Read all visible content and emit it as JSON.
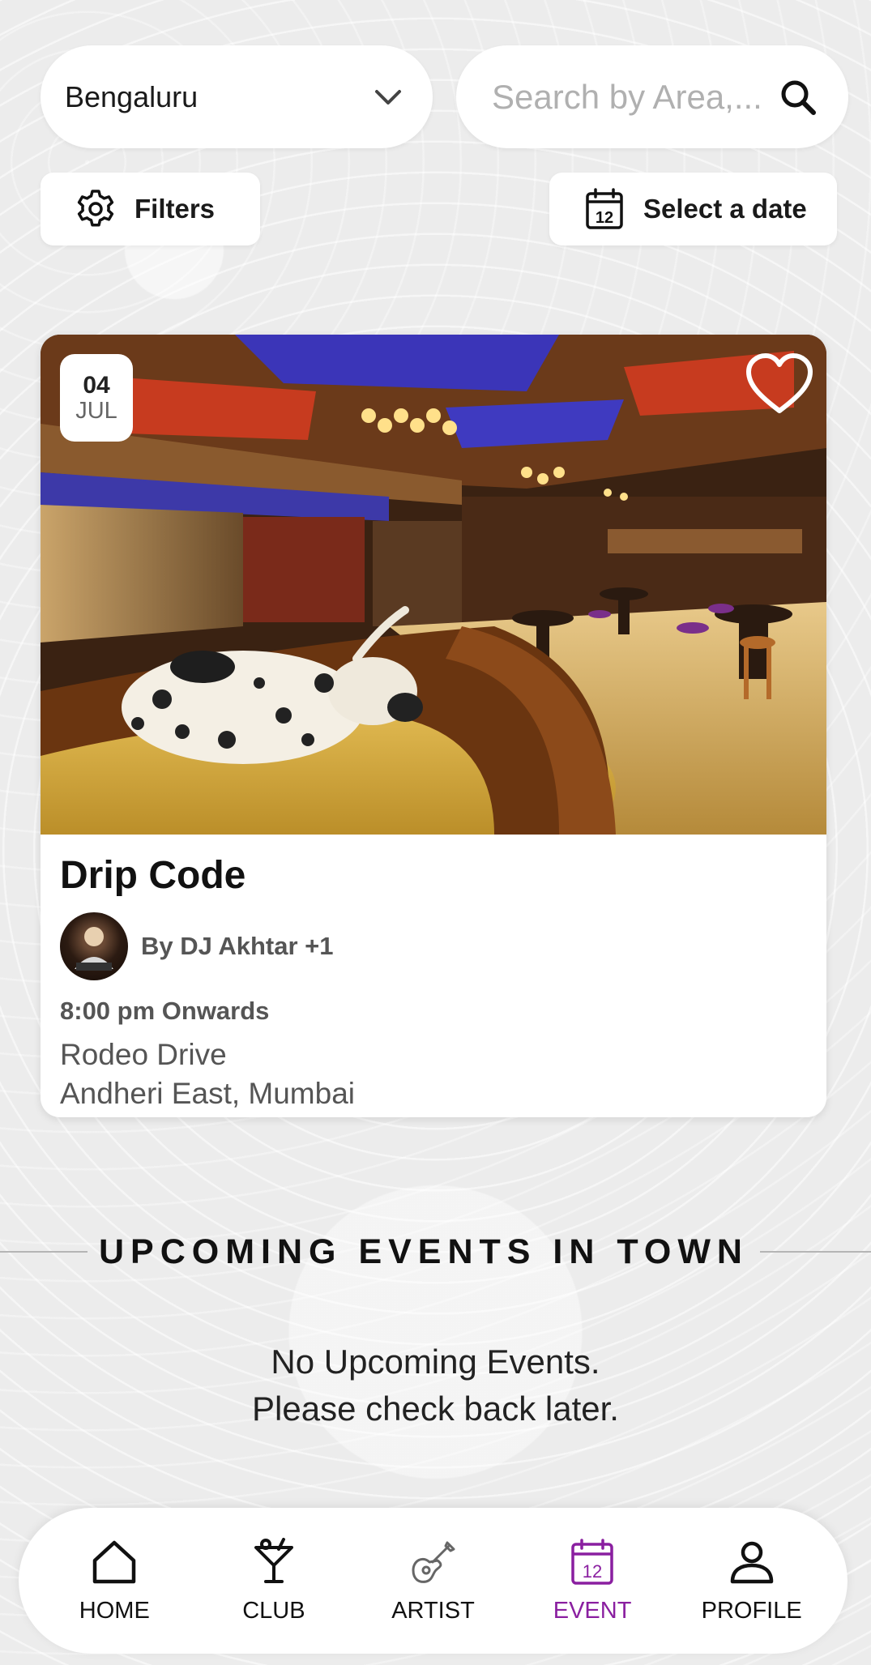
{
  "location": {
    "selected_city": "Bengaluru",
    "dropdown_icon": "chevron-down-icon"
  },
  "search": {
    "placeholder": "Search by Area,...",
    "value": "",
    "icon": "search-icon"
  },
  "filters_button": {
    "label": "Filters",
    "icon": "gear-icon"
  },
  "date_button": {
    "label": "Select a date",
    "icon": "calendar-icon",
    "icon_number": "12"
  },
  "event_card": {
    "date_day": "04",
    "date_month": "JUL",
    "favorite_icon": "heart-icon",
    "title": "Drip Code",
    "artist": "By DJ Akhtar +1",
    "time": "8:00 pm Onwards",
    "venue": "Rodeo Drive",
    "area": "Andheri East, Mumbai"
  },
  "upcoming": {
    "heading": "UPCOMING EVENTS IN TOWN",
    "empty_line1": "No Upcoming Events.",
    "empty_line2": "Please check back later."
  },
  "nav": {
    "items": [
      {
        "label": "HOME",
        "icon": "home-icon",
        "active": false
      },
      {
        "label": "CLUB",
        "icon": "cocktail-icon",
        "active": false
      },
      {
        "label": "ARTIST",
        "icon": "guitar-icon",
        "active": false
      },
      {
        "label": "EVENT",
        "icon": "calendar-icon",
        "active": true,
        "icon_number": "12"
      },
      {
        "label": "PROFILE",
        "icon": "user-icon",
        "active": false
      }
    ]
  },
  "colors": {
    "accent": "#8a1fa0",
    "background": "#ececec",
    "card": "#ffffff",
    "text_muted": "#555555"
  }
}
